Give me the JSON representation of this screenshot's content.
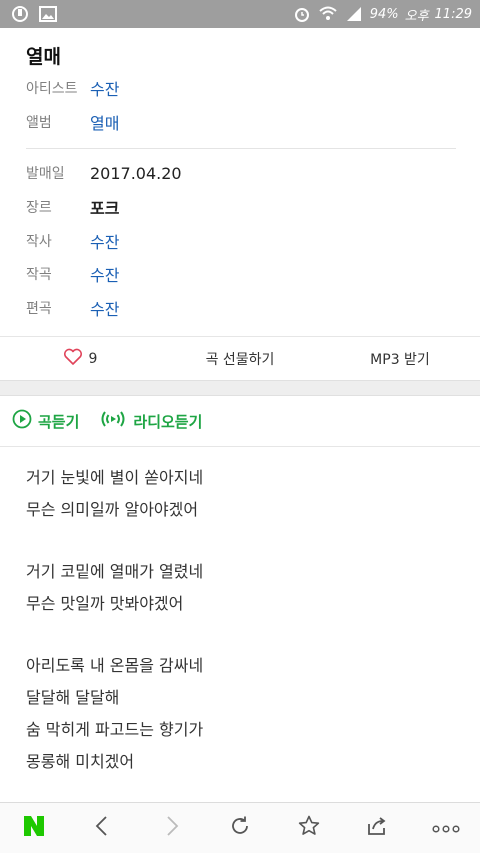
{
  "status": {
    "battery": "94%",
    "ampm": "오후",
    "time": "11:29"
  },
  "song": {
    "title": "열매",
    "meta": [
      {
        "label": "아티스트",
        "value": "수잔",
        "style": "link"
      },
      {
        "label": "앨범",
        "value": "열매",
        "style": "link"
      },
      {
        "label": "발매일",
        "value": "2017.04.20",
        "style": "plain"
      },
      {
        "label": "장르",
        "value": "포크",
        "style": "bold"
      },
      {
        "label": "작사",
        "value": "수잔",
        "style": "link"
      },
      {
        "label": "작곡",
        "value": "수잔",
        "style": "link"
      },
      {
        "label": "편곡",
        "value": "수잔",
        "style": "link"
      }
    ]
  },
  "actions": {
    "like_count": "9",
    "gift_label": "곡 선물하기",
    "mp3_label": "MP3 받기"
  },
  "play": {
    "listen_label": "곡듣기",
    "radio_label": "라디오듣기"
  },
  "lyrics": [
    "거기 눈빛에 별이 쏟아지네",
    "무슨 의미일까 알아야겠어",
    "",
    "거기 코밑에 열매가 열렸네",
    "무슨 맛일까 맛봐야겠어",
    "",
    "아리도록 내 온몸을 감싸네",
    "달달해 달달해",
    "숨 막히게 파고드는 향기가",
    "몽롱해 미치겠어"
  ],
  "colors": {
    "accent_green": "#1ea544",
    "link_blue": "#1a5fb4",
    "heart_red": "#e0435a"
  },
  "icons": {
    "nav": [
      "naver-logo-icon",
      "back-icon",
      "forward-icon",
      "refresh-icon",
      "bookmark-star-icon",
      "share-icon",
      "more-icon"
    ]
  }
}
